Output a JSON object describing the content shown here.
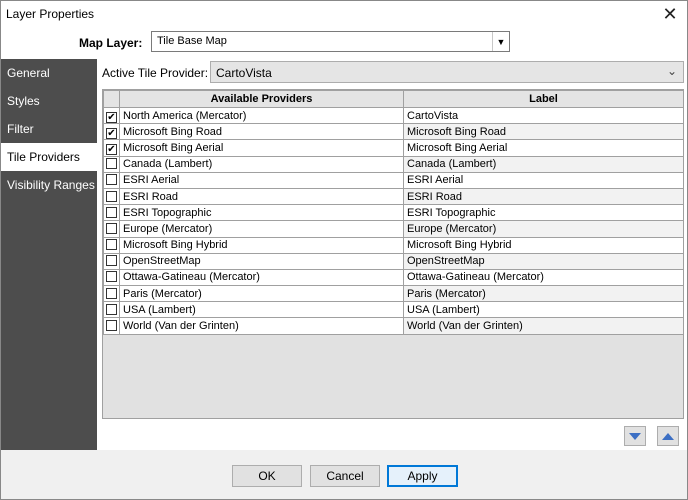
{
  "window": {
    "title": "Layer Properties"
  },
  "header": {
    "map_layer_label": "Map Layer:",
    "map_layer_value": "Tile Base Map"
  },
  "sidebar": {
    "items": [
      {
        "label": "General"
      },
      {
        "label": "Styles"
      },
      {
        "label": "Filter"
      },
      {
        "label": "Tile Providers"
      },
      {
        "label": "Visibility Ranges"
      }
    ]
  },
  "tile_providers": {
    "active_label": "Active Tile Provider:",
    "active_value": "CartoVista",
    "columns": [
      "Available Providers",
      "Label"
    ],
    "rows": [
      {
        "checked": true,
        "provider": "North America (Mercator)",
        "label": "CartoVista"
      },
      {
        "checked": true,
        "provider": "Microsoft Bing Road",
        "label": "Microsoft Bing Road"
      },
      {
        "checked": true,
        "provider": "Microsoft Bing Aerial",
        "label": "Microsoft Bing Aerial"
      },
      {
        "checked": false,
        "provider": "Canada (Lambert)",
        "label": "Canada (Lambert)"
      },
      {
        "checked": false,
        "provider": "ESRI Aerial",
        "label": "ESRI Aerial"
      },
      {
        "checked": false,
        "provider": "ESRI Road",
        "label": "ESRI Road"
      },
      {
        "checked": false,
        "provider": "ESRI Topographic",
        "label": "ESRI Topographic"
      },
      {
        "checked": false,
        "provider": "Europe (Mercator)",
        "label": "Europe (Mercator)"
      },
      {
        "checked": false,
        "provider": "Microsoft Bing Hybrid",
        "label": "Microsoft Bing Hybrid"
      },
      {
        "checked": false,
        "provider": "OpenStreetMap",
        "label": "OpenStreetMap"
      },
      {
        "checked": false,
        "provider": "Ottawa-Gatineau (Mercator)",
        "label": "Ottawa-Gatineau (Mercator)"
      },
      {
        "checked": false,
        "provider": "Paris (Mercator)",
        "label": "Paris (Mercator)"
      },
      {
        "checked": false,
        "provider": "USA (Lambert)",
        "label": "USA (Lambert)"
      },
      {
        "checked": false,
        "provider": "World (Van der Grinten)",
        "label": "World (Van der Grinten)"
      }
    ]
  },
  "footer": {
    "ok_label": "OK",
    "cancel_label": "Cancel",
    "apply_label": "Apply"
  },
  "glyphs": {
    "close": "✕",
    "dropdown": "▼",
    "chevron": "⌄",
    "check": "✔"
  },
  "colors": {
    "sidebar_bg": "#4d4d4d",
    "accent": "#0078d7",
    "arrow": "#3c6fc4"
  }
}
